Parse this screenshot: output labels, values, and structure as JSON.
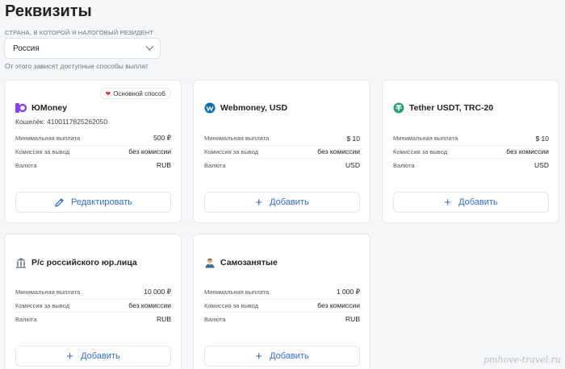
{
  "page": {
    "title": "Реквизиты",
    "country_label": "СТРАНА, В КОТОРОЙ Я НАЛОГОВЫЙ РЕЗИДЕНТ",
    "country_value": "Россия",
    "country_hint": "От этого зависят доступные способы выплат"
  },
  "labels": {
    "min": "Минимальная выплата",
    "fee": "Комиссия за вывод",
    "currency": "Валюта"
  },
  "cards": [
    {
      "name": "ЮMoney",
      "badge": "Основной способ",
      "wallet": "Кошелёк: 4100117825262050",
      "min": "500 ₽",
      "fee": "без комиссии",
      "currency": "RUB",
      "button": "Редактировать",
      "icon": "yoomoney-icon",
      "icon_color": "#8b3ffd"
    },
    {
      "name": "Webmoney, USD",
      "min": "$ 10",
      "fee": "без комиссии",
      "currency": "USD",
      "button": "Добавить",
      "icon": "webmoney-icon",
      "icon_color": "#036cb5"
    },
    {
      "name": "Tether USDT, TRC-20",
      "min": "$ 10",
      "fee": "без комиссии",
      "currency": "USD",
      "button": "Добавить",
      "icon": "tether-icon",
      "icon_color": "#26a17b"
    },
    {
      "name": "Р/с российского юр.лица",
      "min": "10 000 ₽",
      "fee": "без комиссии",
      "currency": "RUB",
      "button": "Добавить",
      "icon": "bank-icon",
      "icon_color": "#6b7280"
    },
    {
      "name": "Самозанятые",
      "min": "1 000 ₽",
      "fee": "без комиссии",
      "currency": "RUB",
      "button": "Добавить",
      "icon": "person-icon",
      "icon_color": "#e0a040"
    }
  ],
  "watermark": "pmhove-travel.ru",
  "colors": {
    "accent": "#2f6be0",
    "background": "#f5f6f8"
  }
}
